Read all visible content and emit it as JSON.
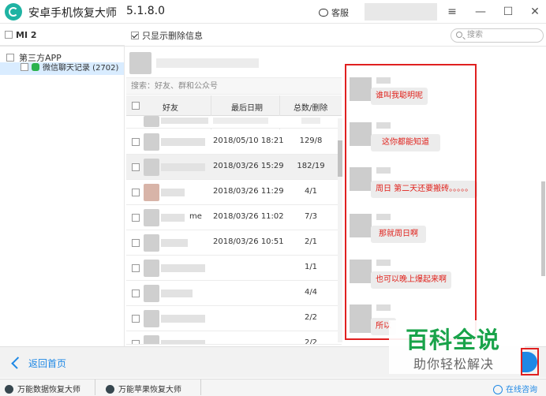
{
  "titlebar": {
    "app_name": "安卓手机恢复大师",
    "version": "5.1.8.0",
    "service_label": "客服"
  },
  "toolbar": {
    "device_name": "MI 2",
    "filter_label": "只显示删除信息",
    "search_placeholder": "搜索"
  },
  "tree": {
    "root_label": "第三方APP",
    "child_label": "微信聊天记录 (2702)"
  },
  "list": {
    "search_hint": "搜索：好友、群和公众号",
    "headers": {
      "friend": "好友",
      "last_date": "最后日期",
      "counts": "总数/删除"
    },
    "rows": [
      {
        "tag": "",
        "date": "2018/05/10 18:21",
        "counts": "129/8"
      },
      {
        "tag": "",
        "date": "2018/03/26 15:29",
        "counts": "182/19"
      },
      {
        "tag": "",
        "date": "2018/03/26 11:29",
        "counts": "4/1"
      },
      {
        "tag": "me",
        "date": "2018/03/26 11:02",
        "counts": "7/3"
      },
      {
        "tag": "",
        "date": "2018/03/26 10:51",
        "counts": "2/1"
      },
      {
        "tag": "",
        "date": "",
        "counts": "1/1"
      },
      {
        "tag": "",
        "date": "",
        "counts": "4/4"
      },
      {
        "tag": "",
        "date": "",
        "counts": "2/2"
      },
      {
        "tag": "",
        "date": "",
        "counts": "2/2"
      }
    ]
  },
  "chat": {
    "messages": [
      {
        "text": "谁叫我聪明呢"
      },
      {
        "text": "这你都能知道"
      },
      {
        "text": "周日 第二天还要搬砖。。。。。"
      },
      {
        "text": "那就周日啊"
      },
      {
        "text": "也可以晚上爆起来啊"
      },
      {
        "text": "所以"
      }
    ]
  },
  "footer": {
    "back_label": "返回首页"
  },
  "watermark": {
    "big": "百科全说",
    "small": "助你轻松解决"
  },
  "statusbar": {
    "item1": "万能数据恢复大师",
    "item2": "万能苹果恢复大师",
    "online": "在线咨询"
  },
  "colors": {
    "accent": "#1e88e5",
    "highlight_red": "#e02020",
    "brand_teal": "#1fb3a3",
    "wechat_green": "#2bb24c"
  }
}
